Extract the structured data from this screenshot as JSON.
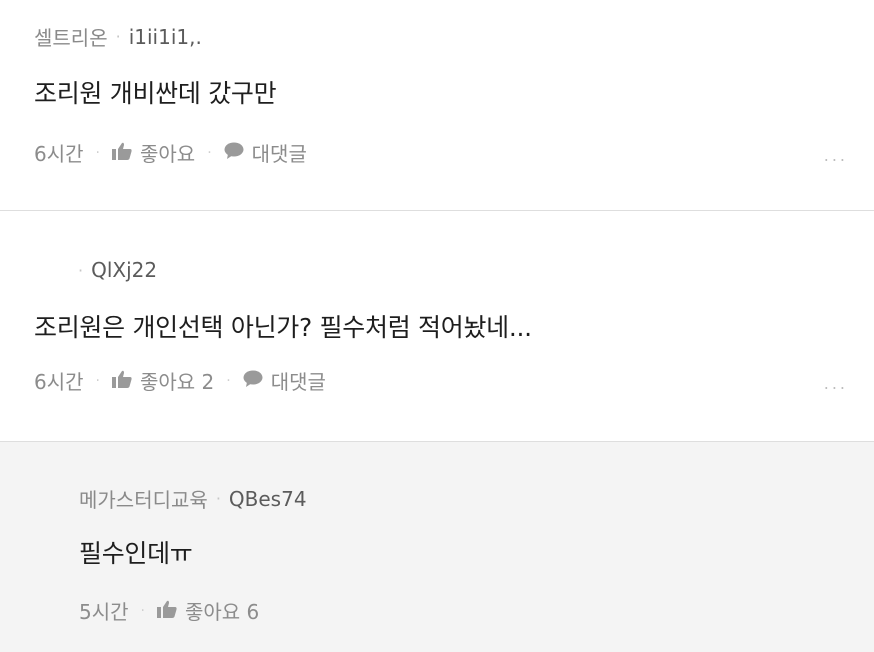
{
  "comments": [
    {
      "author": "셀트리온",
      "user_id": "i1ii1i1,.",
      "text": "조리원 개비싼데 갔구만",
      "time": "6시간",
      "like_label": "좋아요",
      "reply_label": "대댓글",
      "more_label": "..."
    },
    {
      "author": "",
      "user_id": "QlXj22",
      "text": "조리원은 개인선택 아닌가? 필수처럼 적어놨네...",
      "time": "6시간",
      "like_label": "좋아요 2",
      "reply_label": "대댓글",
      "more_label": "..."
    },
    {
      "author": "메가스터디교육",
      "user_id": "QBes74",
      "text": "필수인데ㅠ",
      "time": "5시간",
      "like_label": "좋아요 6"
    }
  ],
  "separator": "·",
  "icons": {
    "like": "thumbs-up-icon",
    "reply": "speech-bubble-icon",
    "more": "more-dots-icon"
  },
  "colors": {
    "meta_text": "#8a8a8a",
    "body_text": "#1e1e1e",
    "reply_background": "#f4f4f4",
    "divider": "#dedede"
  }
}
